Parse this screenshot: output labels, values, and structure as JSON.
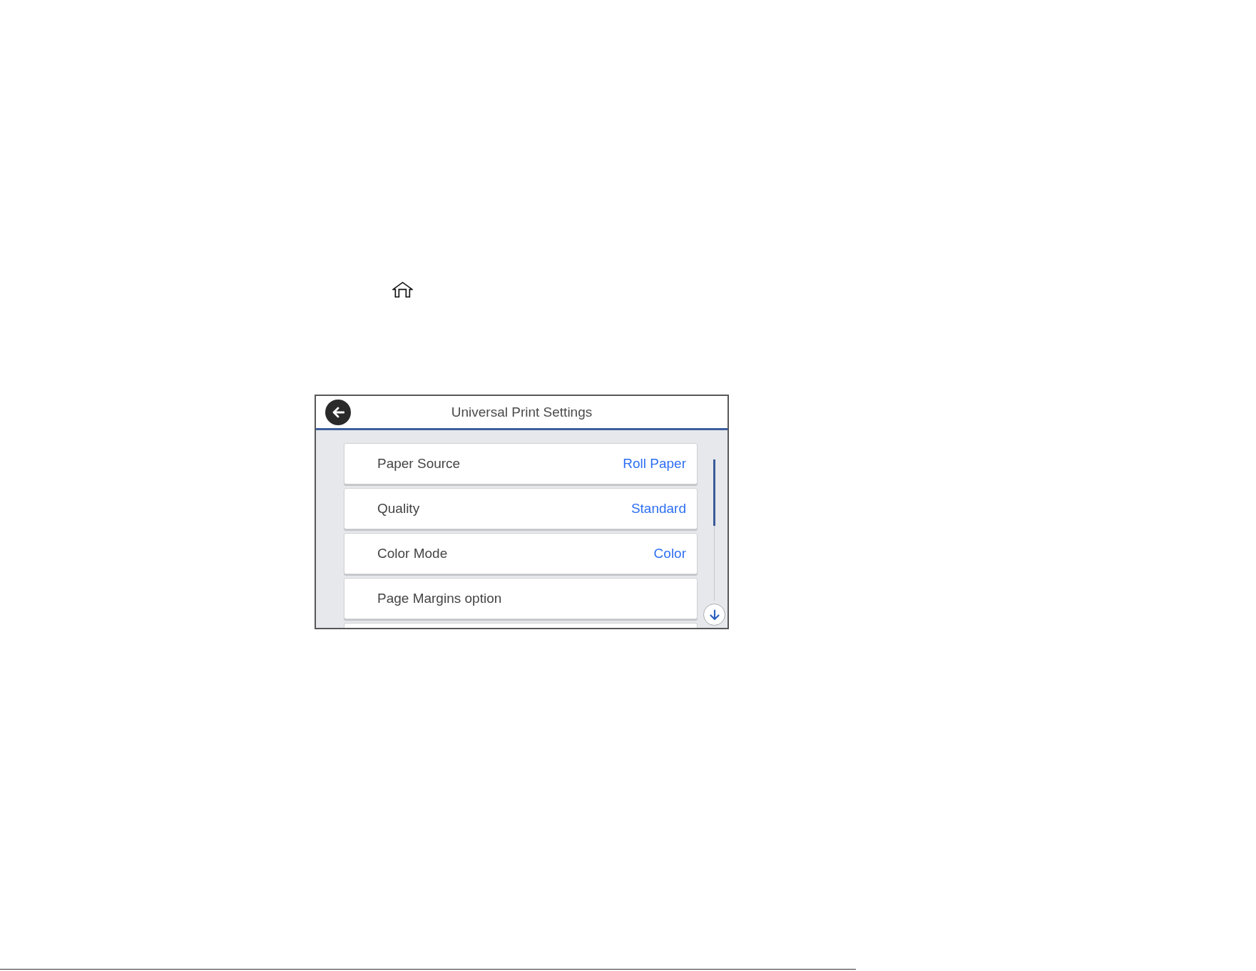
{
  "panel": {
    "title": "Universal Print Settings",
    "settings": [
      {
        "label": "Paper Source",
        "value": "Roll Paper"
      },
      {
        "label": "Quality",
        "value": "Standard"
      },
      {
        "label": "Color Mode",
        "value": "Color"
      },
      {
        "label": "Page Margins option"
      }
    ]
  }
}
